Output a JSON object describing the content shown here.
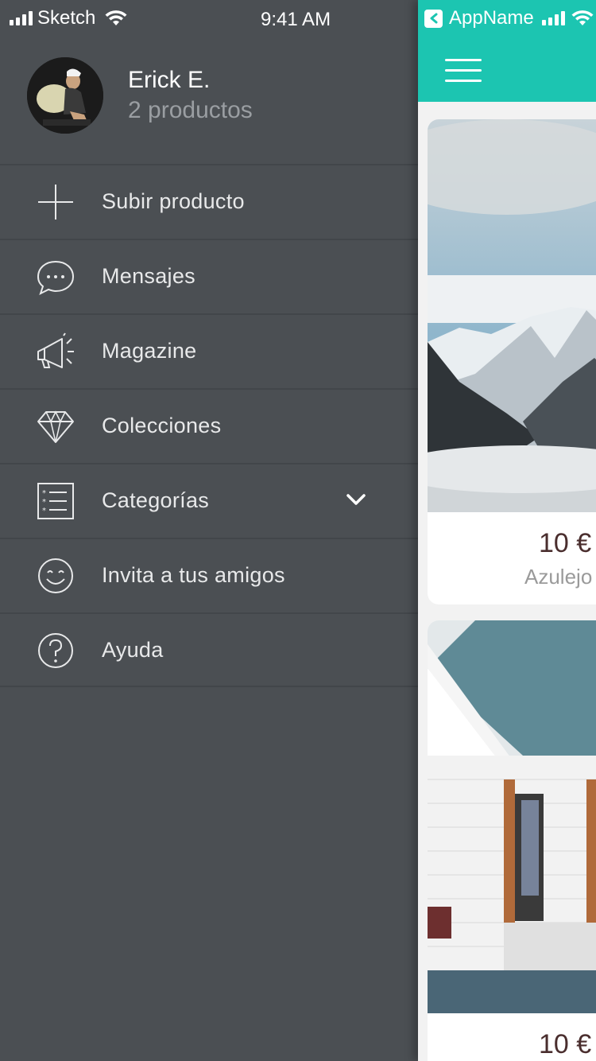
{
  "status_bar": {
    "carrier": "Sketch",
    "time": "9:41 AM"
  },
  "profile": {
    "name": "Erick E.",
    "products": "2 productos"
  },
  "menu": {
    "items": [
      {
        "label": "Subir producto",
        "icon": "plus-icon"
      },
      {
        "label": "Mensajes",
        "icon": "chat-bubble-icon"
      },
      {
        "label": "Magazine",
        "icon": "megaphone-icon"
      },
      {
        "label": "Colecciones",
        "icon": "diamond-icon"
      },
      {
        "label": "Categorías",
        "icon": "list-icon"
      },
      {
        "label": "Invita a tus amigos",
        "icon": "smiley-icon"
      },
      {
        "label": "Ayuda",
        "icon": "help-icon"
      }
    ]
  },
  "app": {
    "status_name": "AppName",
    "cards": [
      {
        "price": "10 €",
        "name": "Azulejo"
      },
      {
        "price": "10 €"
      }
    ]
  },
  "colors": {
    "drawer": "#4b4f53",
    "accent": "#1cc5b1",
    "divider": "#42464a"
  }
}
